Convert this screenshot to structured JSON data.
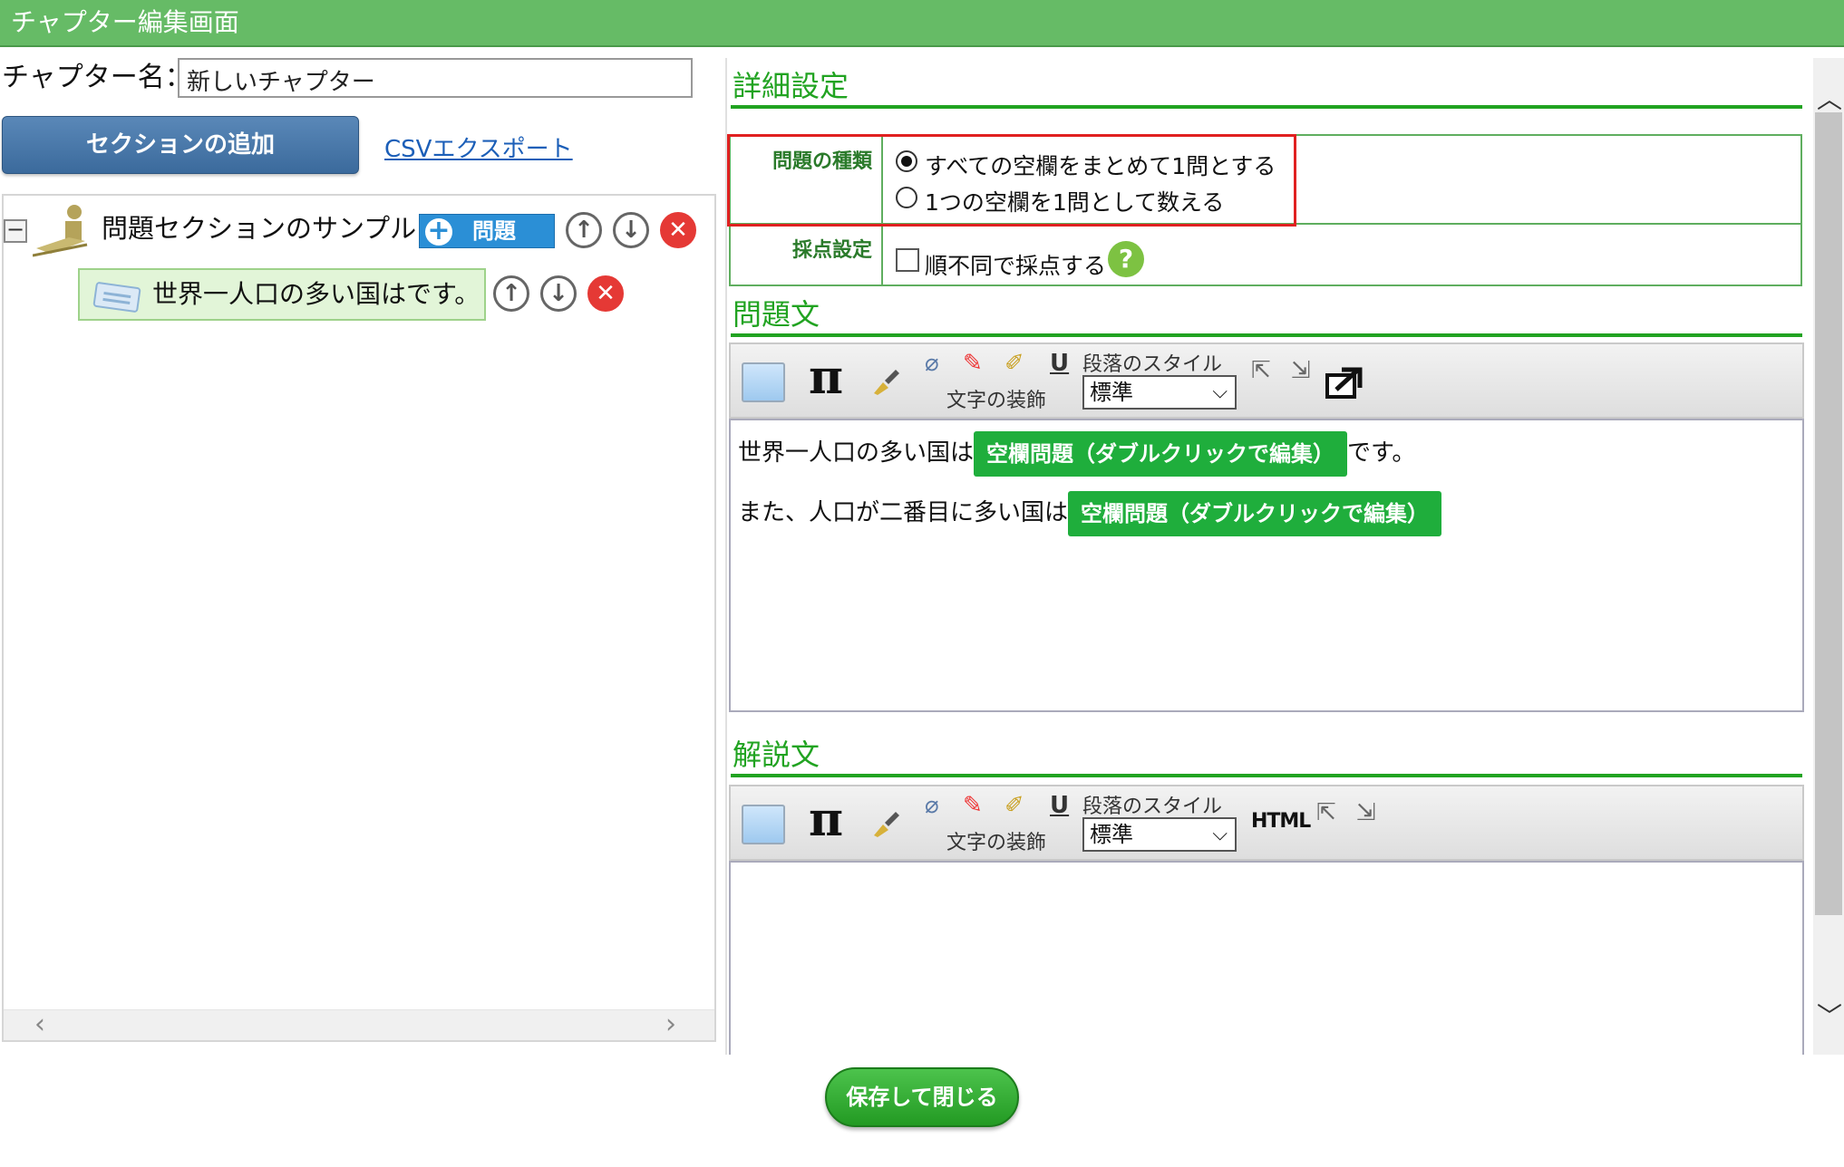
{
  "window": {
    "title": "チャプター編集画面"
  },
  "left": {
    "chapter_label": "チャプター名：",
    "chapter_name_value": "新しいチャプター",
    "add_section_label": "セクションの追加",
    "csv_export_label": "CSVエクスポート",
    "tree": {
      "collapse_symbol": "−",
      "section": {
        "label": "問題セクションのサンプル",
        "add_question_label": "問題",
        "up_symbol": "↑",
        "down_symbol": "↓",
        "delete_symbol": "✕"
      },
      "question": {
        "label": "世界一人口の多い国はです。",
        "up_symbol": "↑",
        "down_symbol": "↓",
        "delete_symbol": "✕"
      },
      "scroll_left": "‹",
      "scroll_right": "›"
    }
  },
  "right": {
    "detail_heading": "詳細設定",
    "settings": {
      "type_label": "問題の種類",
      "type_options": [
        {
          "label": "すべての空欄をまとめて1問とする",
          "selected": true
        },
        {
          "label": "1つの空欄を1問として数える",
          "selected": false
        }
      ],
      "scoring_label": "採点設定",
      "scoring_option": "順不同で採点する",
      "scoring_checked": false,
      "help_symbol": "?"
    },
    "question_heading": "問題文",
    "explanation_heading": "解説文",
    "toolbar": {
      "icons": [
        "image-icon",
        "pi-icon",
        "brush-icon",
        "eraser-icon",
        "marker-icon",
        "highlighter-icon",
        "underline-icon",
        "indent-icon",
        "outdent-icon"
      ],
      "pi_symbol": "π",
      "underline_symbol": "U",
      "eraser_symbol": "⌀",
      "marker_symbol": "✎",
      "highlighter_symbol": "✐",
      "decoration_caption": "文字の装飾",
      "paragraph_style_label": "段落のスタイル",
      "paragraph_style_value": "標準",
      "arrow_left_symbol": "⇱",
      "arrow_right_symbol": "⇲",
      "html_label": "HTML"
    },
    "question_body": {
      "line1_prefix": "世界一人口の多い国は",
      "line1_blank": "空欄問題（ダブルクリックで編集）",
      "line1_suffix": "です。",
      "line2_prefix": "また、人口が二番目に多い国は",
      "line2_blank": "空欄問題（ダブルクリックで編集）"
    }
  },
  "scrollbar": {
    "up": "︿",
    "down": "﹀"
  },
  "footer": {
    "save_close_label": "保存して閉じる"
  },
  "colors": {
    "accent_green": "#21a321",
    "titlebar": "#66bb66",
    "highlight_red": "#e02020",
    "primary_blue": "#3b6a9c"
  }
}
